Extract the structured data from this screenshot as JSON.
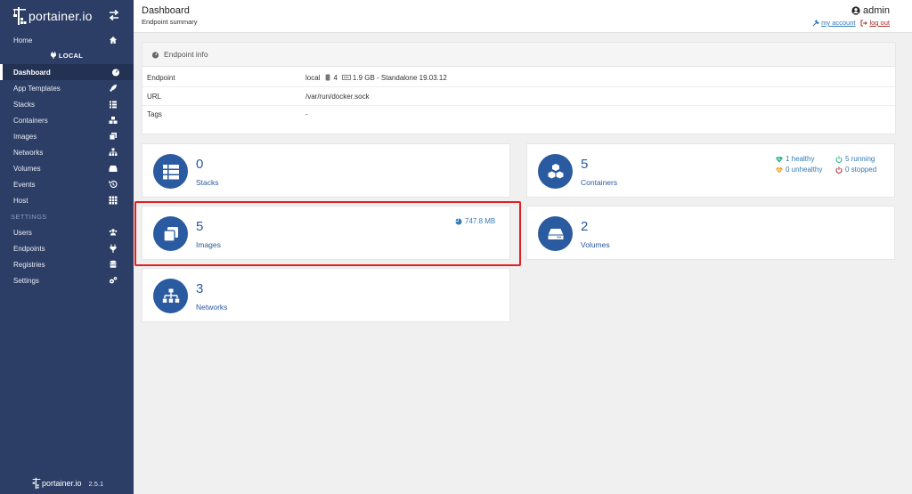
{
  "brand": {
    "name": "portainer.io",
    "version": "2.5.1"
  },
  "sidebar": {
    "home": "Home",
    "endpoint_label": "LOCAL",
    "items": [
      {
        "label": "Dashboard",
        "icon": "dashboard-icon"
      },
      {
        "label": "App Templates",
        "icon": "rocket-icon"
      },
      {
        "label": "Stacks",
        "icon": "th-list-icon"
      },
      {
        "label": "Containers",
        "icon": "cubes-icon"
      },
      {
        "label": "Images",
        "icon": "clone-icon"
      },
      {
        "label": "Networks",
        "icon": "sitemap-icon"
      },
      {
        "label": "Volumes",
        "icon": "hdd-icon"
      },
      {
        "label": "Events",
        "icon": "history-icon"
      },
      {
        "label": "Host",
        "icon": "th-icon"
      }
    ],
    "settings_title": "SETTINGS",
    "settings_items": [
      {
        "label": "Users",
        "icon": "users-icon"
      },
      {
        "label": "Endpoints",
        "icon": "plug-icon"
      },
      {
        "label": "Registries",
        "icon": "database-icon"
      },
      {
        "label": "Settings",
        "icon": "cogs-icon"
      }
    ]
  },
  "header": {
    "title": "Dashboard",
    "subtitle": "Endpoint summary",
    "username": "admin",
    "my_account": "my account",
    "log_out": "log out"
  },
  "endpoint_info": {
    "title": "Endpoint info",
    "endpoint_key": "Endpoint",
    "endpoint_name": "local",
    "cpu": "4",
    "memory": "1.9 GB - Standalone 19.03.12",
    "url_key": "URL",
    "url_value": "/var/run/docker.sock",
    "tags_key": "Tags",
    "tags_value": "-"
  },
  "widgets": {
    "stacks": {
      "count": "0",
      "label": "Stacks"
    },
    "containers": {
      "count": "5",
      "label": "Containers",
      "healthy": "1 healthy",
      "unhealthy": "0 unhealthy",
      "running": "5 running",
      "stopped": "0 stopped"
    },
    "images": {
      "count": "5",
      "label": "Images",
      "size": "747.8 MB"
    },
    "volumes": {
      "count": "2",
      "label": "Volumes"
    },
    "networks": {
      "count": "3",
      "label": "Networks"
    }
  },
  "colors": {
    "sidebar": "#2d3e66",
    "accent": "#2a5aa0",
    "healthy": "#23ae89",
    "unhealthy": "#f0a530",
    "running": "#23ae89",
    "stopped": "#ae2323",
    "highlight": "#e02020"
  }
}
